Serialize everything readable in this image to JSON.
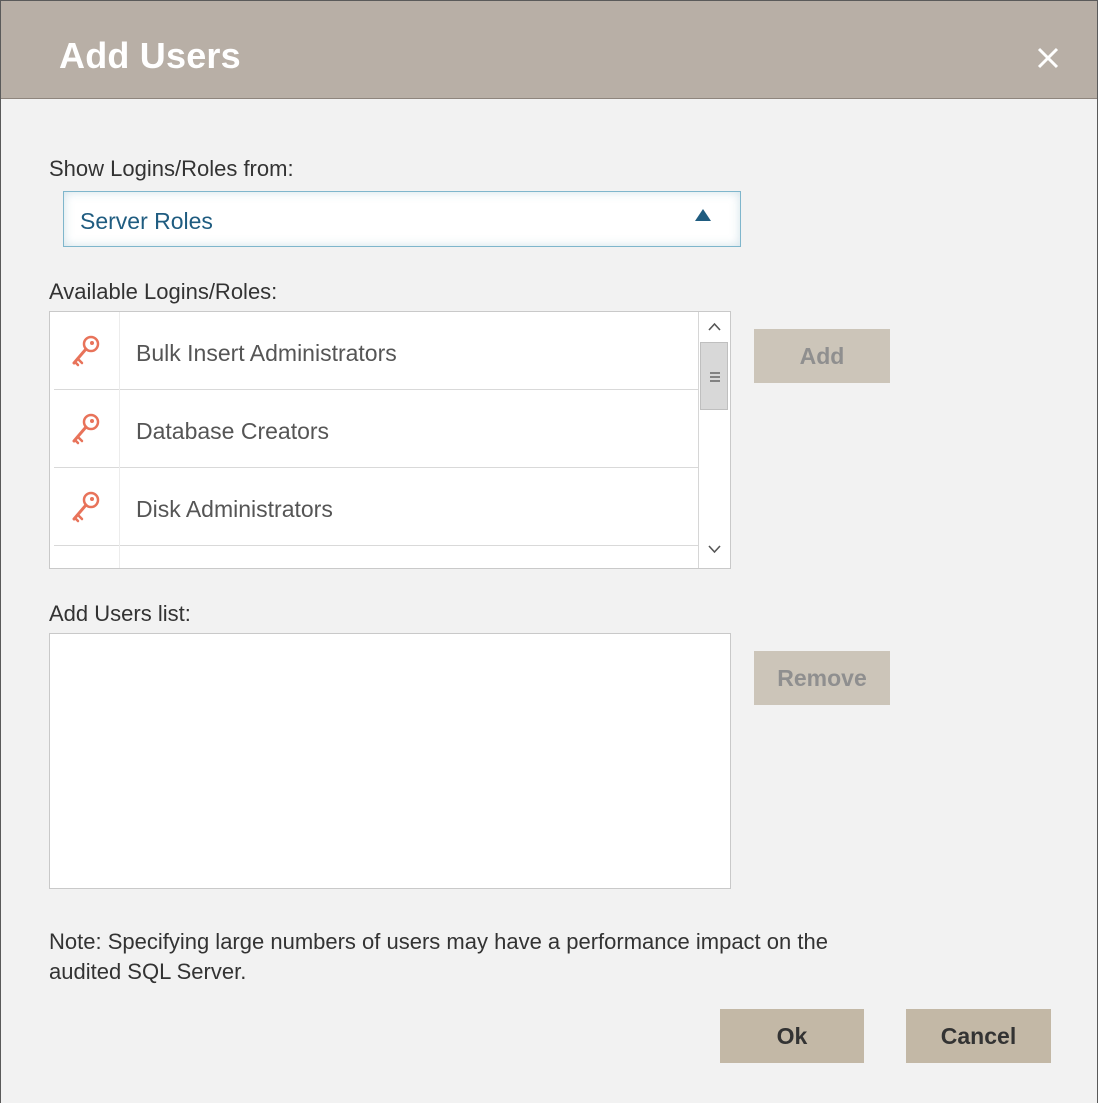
{
  "dialog": {
    "title": "Add Users",
    "close_icon": "close-icon"
  },
  "source": {
    "label": "Show Logins/Roles from:",
    "selected": "Server Roles",
    "arrow_icon": "triangle-up-icon"
  },
  "available": {
    "label": "Available Logins/Roles:",
    "items": [
      {
        "label": "Bulk Insert Administrators",
        "icon": "key-icon"
      },
      {
        "label": "Database Creators",
        "icon": "key-icon"
      },
      {
        "label": "Disk Administrators",
        "icon": "key-icon"
      }
    ],
    "scroll_up_icon": "chevron-up-icon",
    "scroll_down_icon": "chevron-down-icon",
    "thumb_grip_icon": "grip-icon"
  },
  "buttons": {
    "add": "Add",
    "remove": "Remove",
    "ok": "Ok",
    "cancel": "Cancel"
  },
  "users_list": {
    "label": "Add Users list:",
    "items": []
  },
  "note": {
    "line1": "Note: Specifying large numbers of users may have a performance impact on the",
    "line2": "audited SQL Server."
  },
  "colors": {
    "titlebar": "#b8afa6",
    "dialog_bg": "#f2f2f2",
    "dropdown_text": "#1f5c80",
    "key_icon": "#e8735a",
    "disabled_button_bg": "#ccc5b9",
    "footer_button_bg": "#c3b8a6"
  }
}
